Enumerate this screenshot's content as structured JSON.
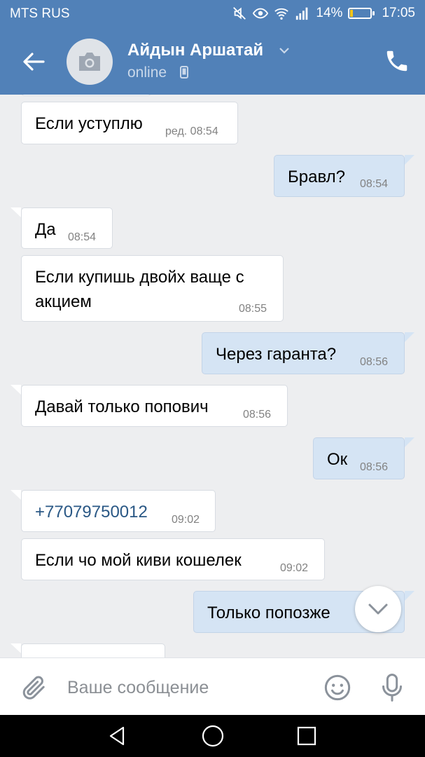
{
  "status_bar": {
    "carrier": "MTS RUS",
    "battery_percent": "14%",
    "battery_level": 0.14,
    "time": "17:05",
    "icons": [
      "mute-icon",
      "eye-icon",
      "wifi-icon",
      "signal-icon",
      "battery-icon"
    ]
  },
  "header": {
    "contact_name": "Айдын Аршатай",
    "status": "online",
    "icons": [
      "back-arrow-icon",
      "camera-icon",
      "chevron-down-icon",
      "mobile-phone-icon",
      "call-icon"
    ]
  },
  "messages": [
    {
      "dir": "in",
      "text": "Если уступлю",
      "time": "ред. 08:54"
    },
    {
      "dir": "out",
      "text": "Бравл?",
      "time": "08:54"
    },
    {
      "dir": "in",
      "text": "Да",
      "time": "08:54"
    },
    {
      "dir": "in",
      "text": "Если купишь двойх ваще с",
      "text2": "акцием",
      "time": "08:55"
    },
    {
      "dir": "out",
      "text": "Через гаранта?",
      "time": "08:56"
    },
    {
      "dir": "in",
      "text": "Давай только попович",
      "time": "08:56"
    },
    {
      "dir": "out",
      "text": "Ок",
      "time": "08:56"
    },
    {
      "dir": "in",
      "text": "+77079750012",
      "time": "09:02"
    },
    {
      "dir": "in",
      "text": "Если чо мой киви кошелек",
      "time": "09:02"
    },
    {
      "dir": "out",
      "text": "Только попозже",
      "time": ""
    }
  ],
  "composer": {
    "placeholder": "Ваше сообщение",
    "icons": [
      "paperclip-icon",
      "emoji-icon",
      "microphone-icon"
    ]
  },
  "navbar": {
    "icons": [
      "nav-back-icon",
      "nav-home-icon",
      "nav-recent-icon"
    ]
  },
  "colors": {
    "header_bg": "#5181b8",
    "chat_bg": "#edeef0",
    "incoming_bubble": "#ffffff",
    "outgoing_bubble": "#d5e4f4",
    "link": "#2a5885"
  }
}
